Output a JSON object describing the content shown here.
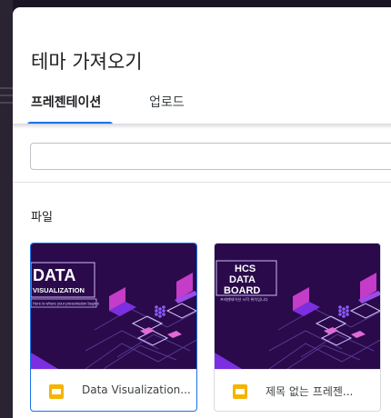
{
  "dialog": {
    "title": "테마 가져오기",
    "tabs": [
      {
        "label": "프레젠테이션",
        "active": true
      },
      {
        "label": "업로드",
        "active": false
      }
    ],
    "search": {
      "value": "",
      "placeholder": ""
    },
    "section_label": "파일",
    "files": [
      {
        "name": "Data Visualization...",
        "thumb_title_lines": [
          "DATA",
          "VISUALIZATION"
        ],
        "thumb_subtitle": "Here is where your presentation begins",
        "selected": true
      },
      {
        "name": "제목 없는 프레젠...",
        "thumb_title_lines": [
          "HCS",
          "DATA",
          "BOARD"
        ],
        "thumb_subtitle": "프레젠테이션 시작 위치입니다",
        "selected": false
      }
    ]
  },
  "colors": {
    "accent": "#1a73e8",
    "slides_icon": "#f4b400",
    "thumb_bg": "#2a0a4a",
    "thumb_purple": "#7b2fe0",
    "thumb_magenta": "#c43cc8",
    "backdrop": "#1b1424"
  },
  "icons": {
    "file_type": "google-slides-icon"
  }
}
